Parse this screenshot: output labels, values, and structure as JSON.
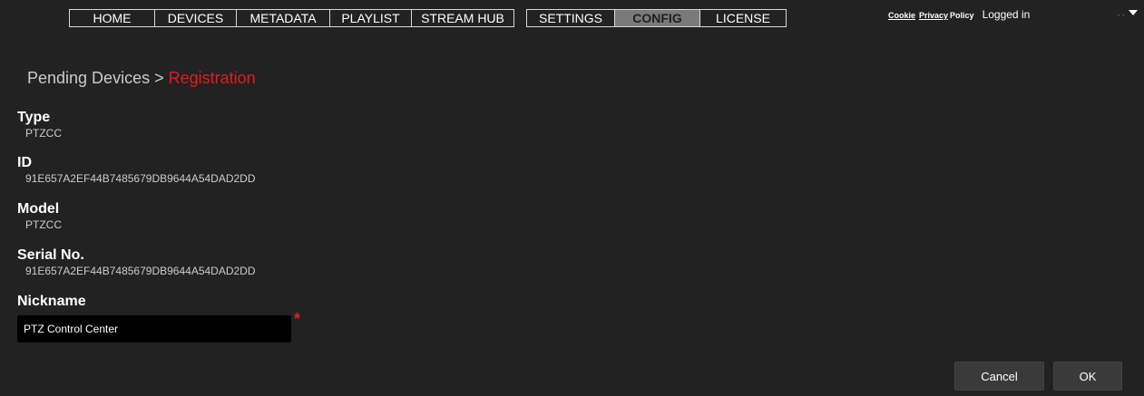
{
  "nav": {
    "group1": [
      "HOME",
      "DEVICES",
      "METADATA",
      "PLAYLIST",
      "STREAM HUB"
    ],
    "group2": [
      "SETTINGS",
      "CONFIG",
      "LICENSE"
    ],
    "active": "CONFIG"
  },
  "header": {
    "cookie_link": "Cookie",
    "privacy_link": "Privacy",
    "policy_text": "Policy",
    "logged_in": "Logged in",
    "user_dots": ". ."
  },
  "breadcrumb": {
    "parent": "Pending Devices",
    "separator": " > ",
    "current": "Registration"
  },
  "fields": {
    "type": {
      "label": "Type",
      "value": "PTZCC"
    },
    "id": {
      "label": "ID",
      "value": "91E657A2EF44B7485679DB9644A54DAD2DD"
    },
    "model": {
      "label": "Model",
      "value": "PTZCC"
    },
    "serial": {
      "label": "Serial No.",
      "value": "91E657A2EF44B7485679DB9644A54DAD2DD"
    },
    "nickname": {
      "label": "Nickname",
      "value": "PTZ Control Center",
      "required_mark": "*"
    }
  },
  "buttons": {
    "cancel": "Cancel",
    "ok": "OK"
  },
  "colors": {
    "background": "#222222",
    "accent_red": "#e01e1e",
    "nav_active_bg": "#7a7a7a"
  }
}
